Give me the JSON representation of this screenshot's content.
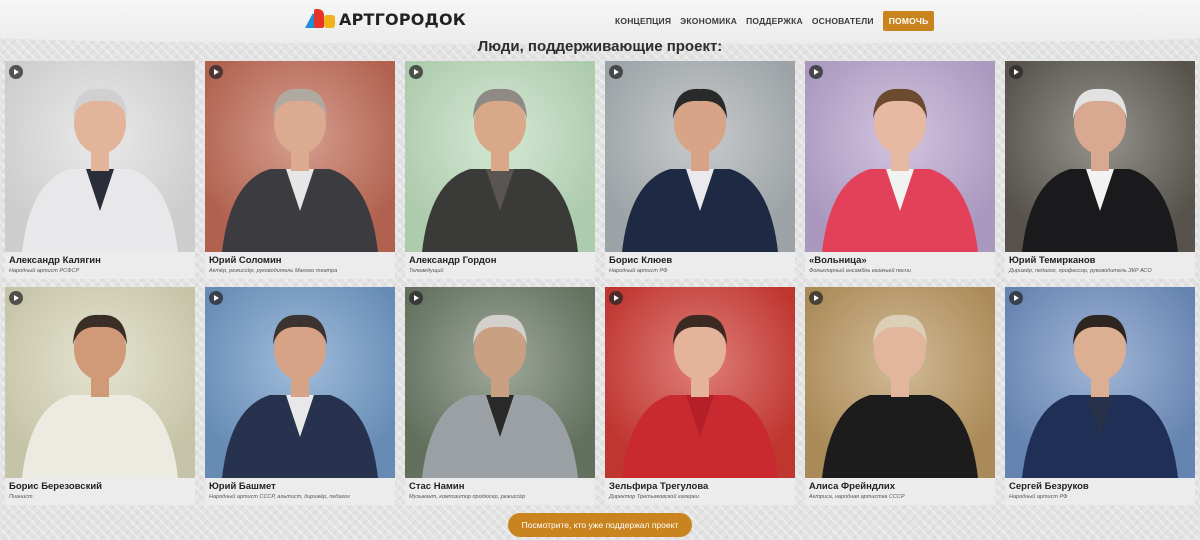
{
  "header": {
    "logo_text": "АРТГОРОДОК",
    "nav": [
      "КОНЦЕПЦИЯ",
      "ЭКОНОМИКА",
      "ПОДДЕРЖКА",
      "ОСНОВАТЕЛИ"
    ],
    "help_button": "ПОМОЧЬ"
  },
  "page_title": "Люди, поддерживающие проект:",
  "cards": [
    {
      "name": "Александр Калягин",
      "role": "Народный артист РСФСР",
      "bg": "#dedede",
      "skin": "#e2b49a",
      "hair": "#d0d0d0",
      "clothes": "#e8e8ea",
      "inner": "#2a2d3a"
    },
    {
      "name": "Юрий Соломин",
      "role": "Актёр, режиссёр, руководитель Малого театра",
      "bg": "#c06a55",
      "skin": "#dcaa90",
      "hair": "#b0a9a0",
      "clothes": "#3c3c40",
      "inner": "#e6e6e6"
    },
    {
      "name": "Александр Гордон",
      "role": "Телеведущий",
      "bg": "#bcdcbc",
      "skin": "#d8a888",
      "hair": "#8f8a86",
      "clothes": "#3a3a38",
      "inner": "#5a5550"
    },
    {
      "name": "Борис Клюев",
      "role": "Народный артист РФ",
      "bg": "#aab0b4",
      "skin": "#d8a488",
      "hair": "#2a2a2a",
      "clothes": "#1e2a44",
      "inner": "#e9e9ee"
    },
    {
      "name": "«Вольница»",
      "role": "Фольклорный ансамбль казачьей песни",
      "bg": "#b9a5cf",
      "skin": "#e8b9a2",
      "hair": "#6b4a30",
      "clothes": "#e3405a",
      "inner": "#f2f2f2"
    },
    {
      "name": "Юрий Темирканов",
      "role": "Дирижёр, педагог, профессор, руководитель ЗКР АСО",
      "bg": "#5e5a52",
      "skin": "#d8a890",
      "hair": "#e2e2e2",
      "clothes": "#1a1a1c",
      "inner": "#f2f2f2"
    },
    {
      "name": "Борис Березовский",
      "role": "Пианист",
      "bg": "#d7d5b6",
      "skin": "#d09a78",
      "hair": "#3a2e26",
      "clothes": "#ecebe2",
      "inner": "#ecebe2"
    },
    {
      "name": "Юрий Башмет",
      "role": "Народный артист СССР, альтист, дирижёр, педагог",
      "bg": "#6f98c6",
      "skin": "#d6a386",
      "hair": "#3b3330",
      "clothes": "#27324e",
      "inner": "#e8e8e8"
    },
    {
      "name": "Стас Намин",
      "role": "Музыкант, композитор продюсер, режиссёр",
      "bg": "#6b7a66",
      "skin": "#caa083",
      "hair": "#d4d0cc",
      "clothes": "#9aa0a4",
      "inner": "#2a2a2a"
    },
    {
      "name": "Зельфира Трегулова",
      "role": "Директор Третьяковской галереи",
      "bg": "#cf3a33",
      "skin": "#e4b39a",
      "hair": "#3a2a22",
      "clothes": "#c92a30",
      "inner": "#b51f27"
    },
    {
      "name": "Алиса Фрейндлих",
      "role": "Актриса, народная артистка СССР",
      "bg": "#b9965f",
      "skin": "#e2b69c",
      "hair": "#dccfb8",
      "clothes": "#1c1c1c",
      "inner": "#1c1c1c"
    },
    {
      "name": "Сергей Безруков",
      "role": "Народный артист РФ",
      "bg": "#6f8fc0",
      "skin": "#dcae92",
      "hair": "#2e2520",
      "clothes": "#1f2f55",
      "inner": "#27314a"
    }
  ],
  "show_supporters_button": "Посмотрите, кто уже поддержал проект"
}
